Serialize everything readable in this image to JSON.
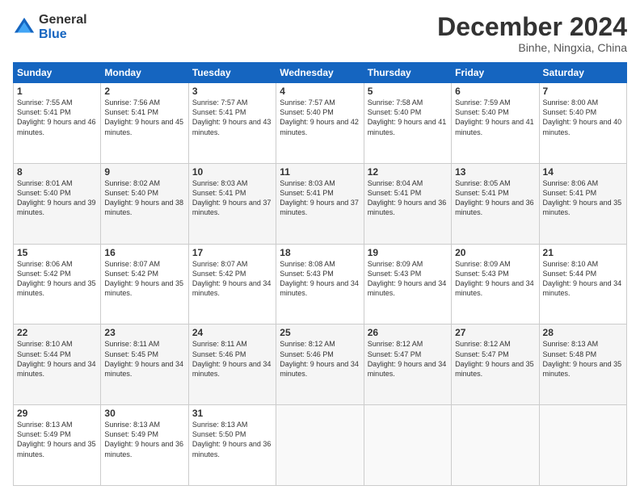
{
  "header": {
    "logo_line1": "General",
    "logo_line2": "Blue",
    "title": "December 2024",
    "subtitle": "Binhe, Ningxia, China"
  },
  "days_of_week": [
    "Sunday",
    "Monday",
    "Tuesday",
    "Wednesday",
    "Thursday",
    "Friday",
    "Saturday"
  ],
  "weeks": [
    [
      {
        "day": "1",
        "sunrise": "7:55 AM",
        "sunset": "5:41 PM",
        "daylight": "9 hours and 46 minutes."
      },
      {
        "day": "2",
        "sunrise": "7:56 AM",
        "sunset": "5:41 PM",
        "daylight": "9 hours and 45 minutes."
      },
      {
        "day": "3",
        "sunrise": "7:57 AM",
        "sunset": "5:41 PM",
        "daylight": "9 hours and 43 minutes."
      },
      {
        "day": "4",
        "sunrise": "7:57 AM",
        "sunset": "5:40 PM",
        "daylight": "9 hours and 42 minutes."
      },
      {
        "day": "5",
        "sunrise": "7:58 AM",
        "sunset": "5:40 PM",
        "daylight": "9 hours and 41 minutes."
      },
      {
        "day": "6",
        "sunrise": "7:59 AM",
        "sunset": "5:40 PM",
        "daylight": "9 hours and 41 minutes."
      },
      {
        "day": "7",
        "sunrise": "8:00 AM",
        "sunset": "5:40 PM",
        "daylight": "9 hours and 40 minutes."
      }
    ],
    [
      {
        "day": "8",
        "sunrise": "8:01 AM",
        "sunset": "5:40 PM",
        "daylight": "9 hours and 39 minutes."
      },
      {
        "day": "9",
        "sunrise": "8:02 AM",
        "sunset": "5:40 PM",
        "daylight": "9 hours and 38 minutes."
      },
      {
        "day": "10",
        "sunrise": "8:03 AM",
        "sunset": "5:41 PM",
        "daylight": "9 hours and 37 minutes."
      },
      {
        "day": "11",
        "sunrise": "8:03 AM",
        "sunset": "5:41 PM",
        "daylight": "9 hours and 37 minutes."
      },
      {
        "day": "12",
        "sunrise": "8:04 AM",
        "sunset": "5:41 PM",
        "daylight": "9 hours and 36 minutes."
      },
      {
        "day": "13",
        "sunrise": "8:05 AM",
        "sunset": "5:41 PM",
        "daylight": "9 hours and 36 minutes."
      },
      {
        "day": "14",
        "sunrise": "8:06 AM",
        "sunset": "5:41 PM",
        "daylight": "9 hours and 35 minutes."
      }
    ],
    [
      {
        "day": "15",
        "sunrise": "8:06 AM",
        "sunset": "5:42 PM",
        "daylight": "9 hours and 35 minutes."
      },
      {
        "day": "16",
        "sunrise": "8:07 AM",
        "sunset": "5:42 PM",
        "daylight": "9 hours and 35 minutes."
      },
      {
        "day": "17",
        "sunrise": "8:07 AM",
        "sunset": "5:42 PM",
        "daylight": "9 hours and 34 minutes."
      },
      {
        "day": "18",
        "sunrise": "8:08 AM",
        "sunset": "5:43 PM",
        "daylight": "9 hours and 34 minutes."
      },
      {
        "day": "19",
        "sunrise": "8:09 AM",
        "sunset": "5:43 PM",
        "daylight": "9 hours and 34 minutes."
      },
      {
        "day": "20",
        "sunrise": "8:09 AM",
        "sunset": "5:43 PM",
        "daylight": "9 hours and 34 minutes."
      },
      {
        "day": "21",
        "sunrise": "8:10 AM",
        "sunset": "5:44 PM",
        "daylight": "9 hours and 34 minutes."
      }
    ],
    [
      {
        "day": "22",
        "sunrise": "8:10 AM",
        "sunset": "5:44 PM",
        "daylight": "9 hours and 34 minutes."
      },
      {
        "day": "23",
        "sunrise": "8:11 AM",
        "sunset": "5:45 PM",
        "daylight": "9 hours and 34 minutes."
      },
      {
        "day": "24",
        "sunrise": "8:11 AM",
        "sunset": "5:46 PM",
        "daylight": "9 hours and 34 minutes."
      },
      {
        "day": "25",
        "sunrise": "8:12 AM",
        "sunset": "5:46 PM",
        "daylight": "9 hours and 34 minutes."
      },
      {
        "day": "26",
        "sunrise": "8:12 AM",
        "sunset": "5:47 PM",
        "daylight": "9 hours and 34 minutes."
      },
      {
        "day": "27",
        "sunrise": "8:12 AM",
        "sunset": "5:47 PM",
        "daylight": "9 hours and 35 minutes."
      },
      {
        "day": "28",
        "sunrise": "8:13 AM",
        "sunset": "5:48 PM",
        "daylight": "9 hours and 35 minutes."
      }
    ],
    [
      {
        "day": "29",
        "sunrise": "8:13 AM",
        "sunset": "5:49 PM",
        "daylight": "9 hours and 35 minutes."
      },
      {
        "day": "30",
        "sunrise": "8:13 AM",
        "sunset": "5:49 PM",
        "daylight": "9 hours and 36 minutes."
      },
      {
        "day": "31",
        "sunrise": "8:13 AM",
        "sunset": "5:50 PM",
        "daylight": "9 hours and 36 minutes."
      },
      null,
      null,
      null,
      null
    ]
  ]
}
